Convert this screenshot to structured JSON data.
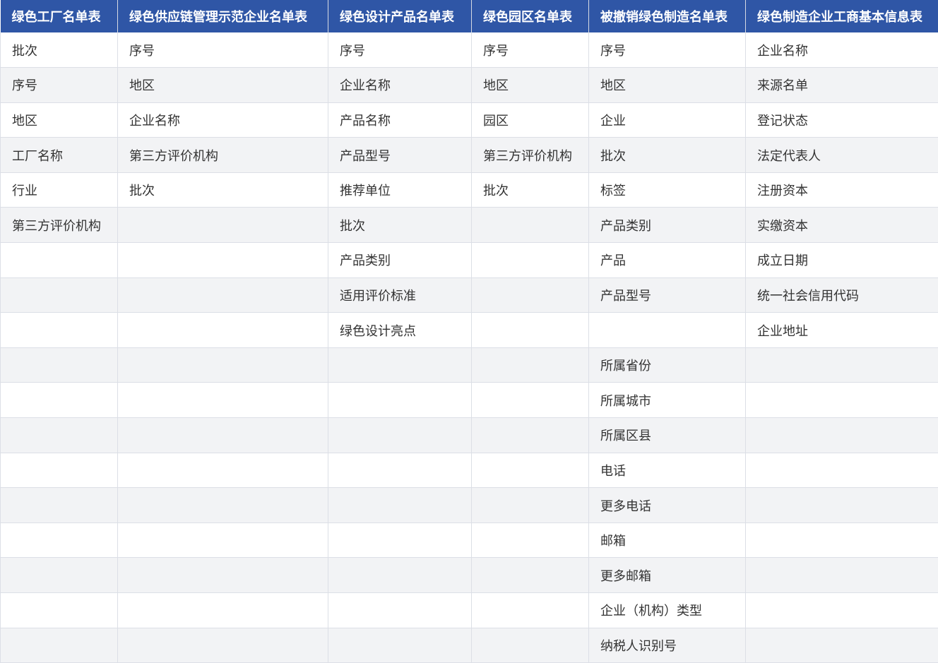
{
  "table": {
    "columns": [
      "绿色工厂名单表",
      "绿色供应链管理示范企业名单表",
      "绿色设计产品名单表",
      "绿色园区名单表",
      "被撤销绿色制造名单表",
      "绿色制造企业工商基本信息表"
    ],
    "rows": [
      [
        "批次",
        "序号",
        "序号",
        "序号",
        "序号",
        "企业名称"
      ],
      [
        "序号",
        "地区",
        "企业名称",
        "地区",
        "地区",
        "来源名单"
      ],
      [
        "地区",
        "企业名称",
        "产品名称",
        "园区",
        "企业",
        "登记状态"
      ],
      [
        "工厂名称",
        "第三方评价机构",
        "产品型号",
        "第三方评价机构",
        "批次",
        "法定代表人"
      ],
      [
        "行业",
        "批次",
        "推荐单位",
        "批次",
        "标签",
        "注册资本"
      ],
      [
        "第三方评价机构",
        "",
        "批次",
        "",
        "产品类别",
        "实缴资本"
      ],
      [
        "",
        "",
        "产品类别",
        "",
        "产品",
        "成立日期"
      ],
      [
        "",
        "",
        "适用评价标准",
        "",
        "产品型号",
        "统一社会信用代码"
      ],
      [
        "",
        "",
        "绿色设计亮点",
        "",
        "",
        "企业地址"
      ],
      [
        "",
        "",
        "",
        "",
        "所属省份",
        ""
      ],
      [
        "",
        "",
        "",
        "",
        "所属城市",
        ""
      ],
      [
        "",
        "",
        "",
        "",
        "所属区县",
        ""
      ],
      [
        "",
        "",
        "",
        "",
        "电话",
        ""
      ],
      [
        "",
        "",
        "",
        "",
        "更多电话",
        ""
      ],
      [
        "",
        "",
        "",
        "",
        "邮箱",
        ""
      ],
      [
        "",
        "",
        "",
        "",
        "更多邮箱",
        ""
      ],
      [
        "",
        "",
        "",
        "",
        "企业（机构）类型",
        ""
      ],
      [
        "",
        "",
        "",
        "",
        "纳税人识别号",
        ""
      ]
    ]
  },
  "colors": {
    "header_bg": "#2f56a6",
    "header_text": "#ffffff",
    "stripe_bg": "#f2f3f5",
    "cell_text": "#333333",
    "border": "#dcdfe6"
  }
}
